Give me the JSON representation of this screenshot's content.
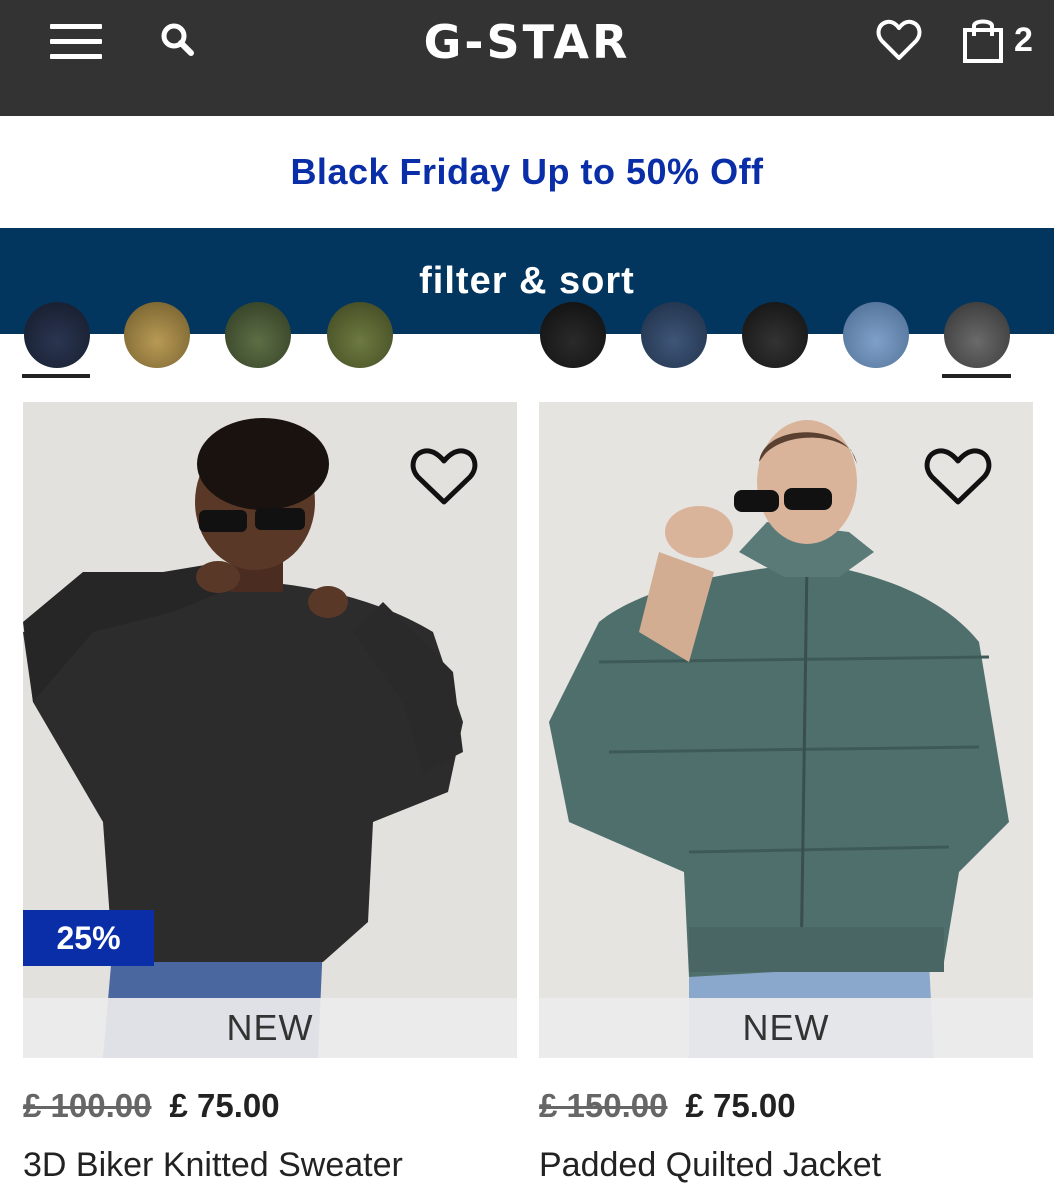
{
  "header": {
    "brand": "G-STAR",
    "bag_count": "2",
    "icons": [
      "menu-icon",
      "search-icon",
      "heart-icon",
      "shopping-bag-icon"
    ]
  },
  "promo": {
    "text": "Black Friday Up to 50% Off"
  },
  "filter": {
    "label": "filter & sort"
  },
  "products": [
    {
      "discount": "25%",
      "badge": "NEW",
      "old_price": "£ 100.00",
      "price": "£ 75.00",
      "name": "3D Biker Knitted Sweater"
    },
    {
      "badge": "NEW",
      "old_price": "£ 150.00",
      "price": "£ 75.00",
      "name": "Padded Quilted Jacket"
    }
  ],
  "colors": {
    "topbar": "#333333",
    "promo_text": "#0a2ea8",
    "filter_bar": "#03365f",
    "discount_badge": "#0a2ea8"
  }
}
